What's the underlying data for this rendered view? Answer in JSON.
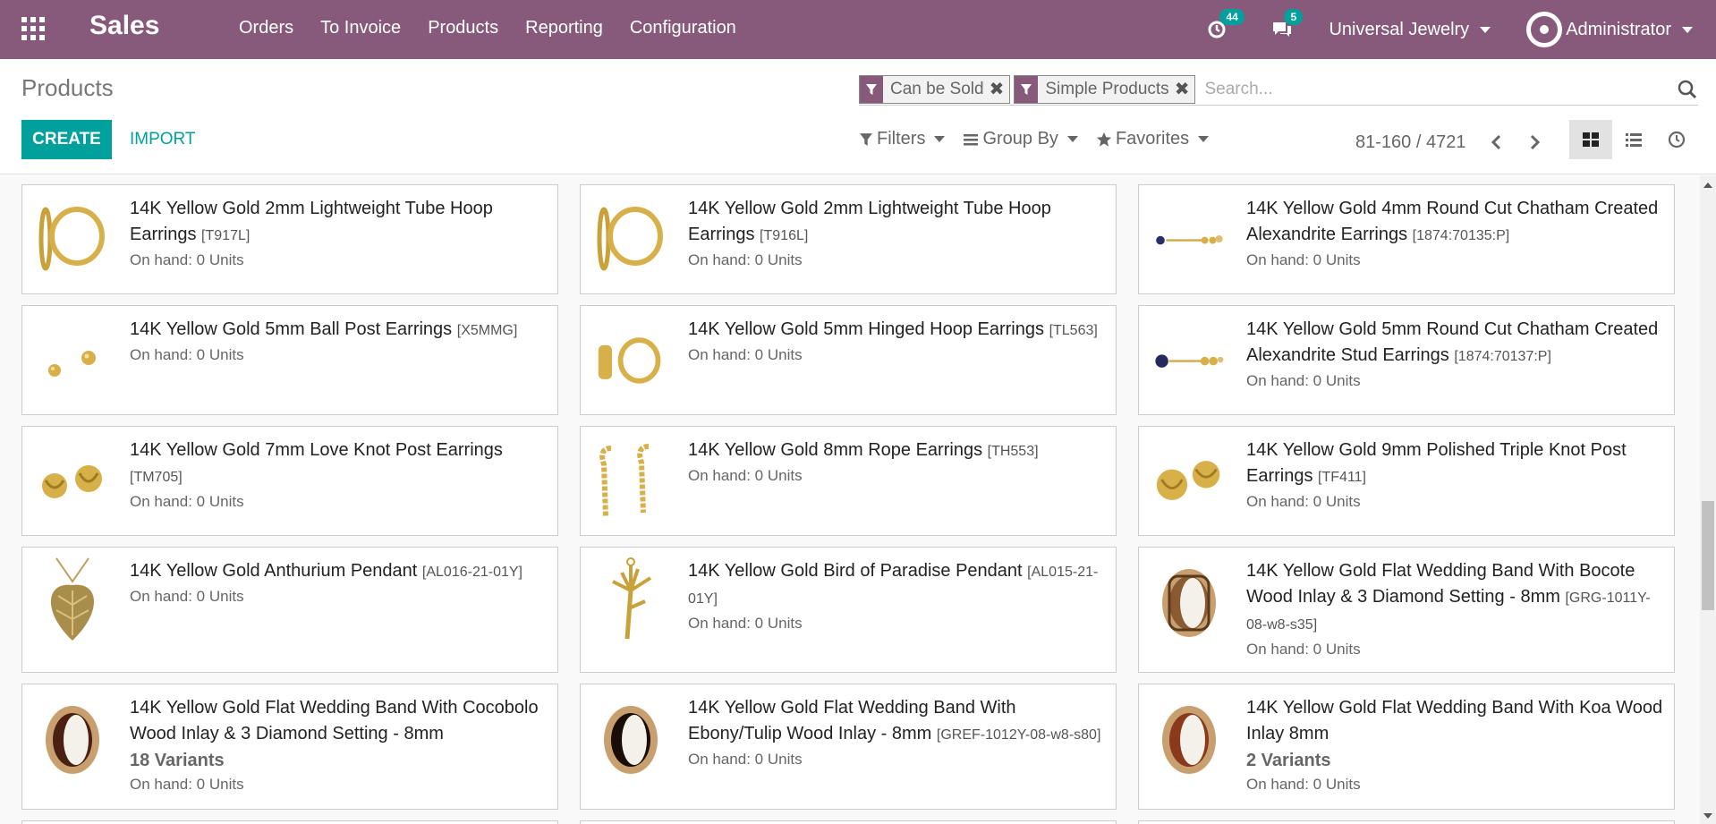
{
  "navbar": {
    "app_name": "Sales",
    "menu": [
      "Orders",
      "To Invoice",
      "Products",
      "Reporting",
      "Configuration"
    ],
    "activity_count": "44",
    "message_count": "5",
    "company": "Universal Jewelry",
    "user": "Administrator",
    "color": "#875a7b"
  },
  "control_panel": {
    "breadcrumb": "Products",
    "facets": [
      "Can be Sold",
      "Simple Products"
    ],
    "search_placeholder": "Search...",
    "create_label": "CREATE",
    "import_label": "IMPORT",
    "filters_label": "Filters",
    "groupby_label": "Group By",
    "favorites_label": "Favorites",
    "pager": "81-160 / 4721",
    "accent": "#00a09d"
  },
  "products": [
    {
      "name": "14K Yellow Gold 2mm Lightweight Tube Hoop Earrings",
      "ref": "[T917L]",
      "onhand": "On hand: 0 Units",
      "image": "hoop-earring"
    },
    {
      "name": "14K Yellow Gold 2mm Lightweight Tube Hoop Earrings",
      "ref": "[T916L]",
      "onhand": "On hand: 0 Units",
      "image": "hoop-earring"
    },
    {
      "name": "14K Yellow Gold 4mm Round Cut Chatham Created Alexandrite Earrings",
      "ref": "[1874:70135:P]",
      "onhand": "On hand: 0 Units",
      "image": "stud-stone-earring"
    },
    {
      "name": "14K Yellow Gold 5mm Ball Post Earrings",
      "ref": "[X5MMG]",
      "onhand": "On hand: 0 Units",
      "image": "ball-earring"
    },
    {
      "name": "14K Yellow Gold 5mm Hinged Hoop Earrings",
      "ref": "[TL563]",
      "onhand": "On hand: 0 Units",
      "image": "huggie-earring"
    },
    {
      "name": "14K Yellow Gold 5mm Round Cut Chatham Created Alexandrite Stud Earrings",
      "ref": "[1874:70137:P]",
      "onhand": "On hand: 0 Units",
      "image": "stud-stone-earring"
    },
    {
      "name": "14K Yellow Gold 7mm Love Knot Post Earrings",
      "ref": "[TM705]",
      "onhand": "On hand: 0 Units",
      "image": "knot-earring"
    },
    {
      "name": "14K Yellow Gold 8mm Rope Earrings",
      "ref": "[TH553]",
      "onhand": "On hand: 0 Units",
      "image": "rope-earring"
    },
    {
      "name": "14K Yellow Gold 9mm Polished Triple Knot Post Earrings",
      "ref": "[TF411]",
      "onhand": "On hand: 0 Units",
      "image": "knot-earring"
    },
    {
      "name": "14K Yellow Gold Anthurium Pendant",
      "ref": "[AL016-21-01Y]",
      "onhand": "On hand: 0 Units",
      "image": "leaf-pendant"
    },
    {
      "name": "14K Yellow Gold Bird of Paradise Pendant",
      "ref": "[AL015-21-01Y]",
      "onhand": "On hand: 0 Units",
      "image": "flower-pendant"
    },
    {
      "name": "14K Yellow Gold Flat Wedding Band With Bocote Wood Inlay & 3 Diamond Setting - 8mm",
      "ref": "[GRG-1011Y-08-w8-s35]",
      "onhand": "On hand: 0 Units",
      "image": "wood-ring"
    },
    {
      "name": "14K Yellow Gold Flat Wedding Band With Cocobolo Wood Inlay & 3 Diamond Setting - 8mm",
      "ref": "",
      "variants": "18 Variants",
      "onhand": "On hand: 0 Units",
      "image": "wood-ring"
    },
    {
      "name": "14K Yellow Gold Flat Wedding Band With Ebony/Tulip Wood Inlay - 8mm",
      "ref": "[GREF-1012Y-08-w8-s80]",
      "onhand": "On hand: 0 Units",
      "image": "dark-ring"
    },
    {
      "name": "14K Yellow Gold Flat Wedding Band With Koa Wood Inlay 8mm",
      "ref": "",
      "variants": "2 Variants",
      "onhand": "On hand: 0 Units",
      "image": "wood-ring"
    }
  ]
}
